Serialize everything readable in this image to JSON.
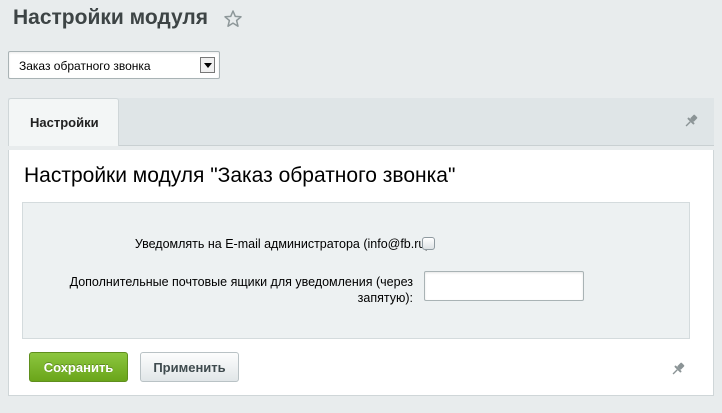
{
  "header": {
    "title": "Настройки модуля"
  },
  "module_select": {
    "selected": "Заказ обратного звонка"
  },
  "tabs": [
    {
      "label": "Настройки"
    }
  ],
  "section": {
    "heading": "Настройки модуля \"Заказ обратного звонка\""
  },
  "form": {
    "notify_label": "Уведомлять на E-mail администратора (info@fb.ru):",
    "notify_checked": false,
    "extra_mailboxes_label": "Дополнительные почтовые ящики для уведомления (через запятую):",
    "extra_mailboxes_value": ""
  },
  "buttons": {
    "save": "Сохранить",
    "apply": "Применить"
  },
  "icons": {
    "favorite": "star-icon",
    "pin": "pin-icon"
  }
}
